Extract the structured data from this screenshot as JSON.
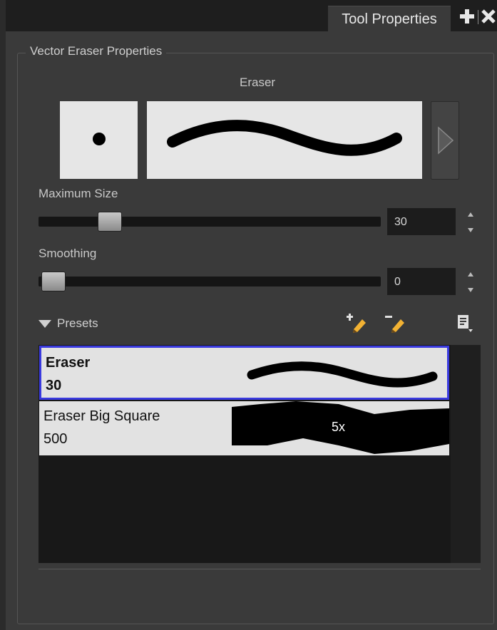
{
  "tab": {
    "title": "Tool Properties"
  },
  "group": {
    "title": "Vector Eraser Properties"
  },
  "tip": {
    "label": "Eraser"
  },
  "max_size": {
    "label": "Maximum Size",
    "value": "30",
    "fraction": 0.18
  },
  "smoothing": {
    "label": "Smoothing",
    "value": "0",
    "fraction": 0.0
  },
  "presets": {
    "label": "Presets",
    "items": [
      {
        "name": "Eraser",
        "value": "30",
        "selected": true
      },
      {
        "name": "Eraser Big Square",
        "value": "500",
        "overlay": "5x",
        "selected": false
      }
    ]
  },
  "colors": {
    "selection": "#3a3adf",
    "panel": "#3a3a3a",
    "preview_bg": "#e6e6e6"
  },
  "icons": [
    "add-icon",
    "close-icon",
    "play-arrow-icon",
    "spin-up-icon",
    "spin-down-icon",
    "new-preset-icon",
    "delete-preset-icon",
    "preset-menu-icon"
  ]
}
